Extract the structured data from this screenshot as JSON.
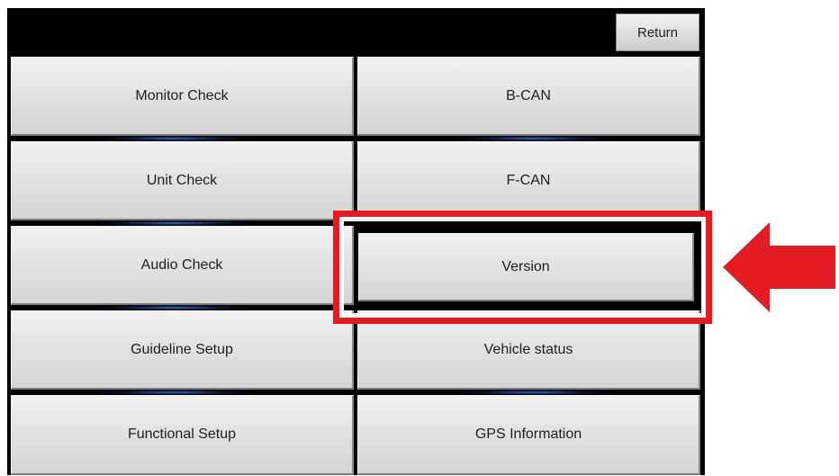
{
  "header": {
    "return_label": "Return"
  },
  "menu": {
    "left": [
      {
        "label": "Monitor Check"
      },
      {
        "label": "Unit Check"
      },
      {
        "label": "Audio Check"
      },
      {
        "label": "Guideline Setup"
      },
      {
        "label": "Functional Setup"
      }
    ],
    "right": [
      {
        "label": "B-CAN"
      },
      {
        "label": "F-CAN"
      },
      {
        "label": "Version"
      },
      {
        "label": "Vehicle status"
      },
      {
        "label": "GPS Information"
      }
    ]
  },
  "annotation": {
    "highlight_color": "#e31b23",
    "highlighted_item": "Version",
    "arrow_icon": "arrow-left-icon"
  },
  "colors": {
    "background": "#000000",
    "button_face": "#e3e3e3",
    "text": "#1e1e1e"
  }
}
